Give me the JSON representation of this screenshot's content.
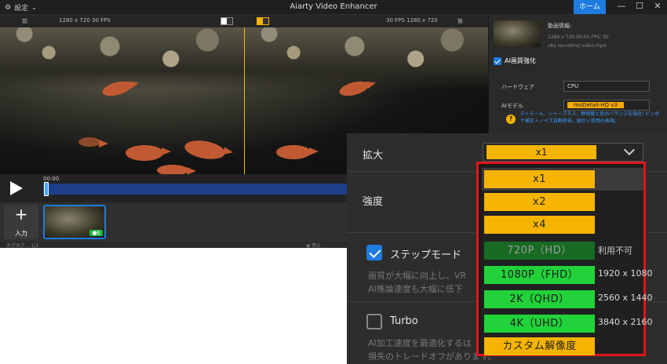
{
  "titlebar": {
    "settings_label": "設定",
    "app_title": "Aiarty Video Enhancer",
    "home_button": "ホーム",
    "minimize": "—",
    "maximize": "☐",
    "close": "✕"
  },
  "compare": {
    "before_label": "前",
    "left_info": "1280 x 720  30 FPS",
    "right_info": "30 FPS  1280 x 720",
    "after_label": "後"
  },
  "timeline": {
    "time": "00:00",
    "progress": 0.0
  },
  "strip": {
    "add_label": "入力",
    "clip_badge": "●E",
    "status_left": "カクカク... 1/1",
    "status_right": "◉ 停止"
  },
  "right_panel": {
    "info_title": "動画情報:",
    "info_meta": "1280 x 720   00:05   FPS: 30",
    "info_file": "obs recording video.mp4",
    "ai_section": "AI画質強化",
    "hardware_label": "ハードウェア",
    "hardware_value": "CPU",
    "model_label": "AIモデル",
    "model_value": "moDetail-HQ v3",
    "description": "ディテール、シャープネス、鮮明度と色のバランスを強化! ビンボケ補正＋ノイズ自動除去。細かい質感の表現。"
  },
  "popup": {
    "scale_label": "拡大",
    "scale_value": "x1",
    "strength_label": "強度",
    "step_mode_label": "ステップモード",
    "step_mode_note1": "画質が大幅に向上し、VR",
    "step_mode_note2": "AI推論速度も大幅に低下",
    "turbo_label": "Turbo",
    "turbo_note1": "AI加工速度を最適化するは",
    "turbo_note2": "損失のトレードオフがあります。"
  },
  "dropdown": {
    "options": [
      {
        "label": "x1",
        "style": "gold",
        "side": ""
      },
      {
        "label": "x2",
        "style": "gold",
        "side": ""
      },
      {
        "label": "x4",
        "style": "gold",
        "side": ""
      },
      {
        "label": "720P（HD）",
        "style": "dark",
        "side": "利用不可"
      },
      {
        "label": "1080P（FHD）",
        "style": "green",
        "side": "1920 x 1080"
      },
      {
        "label": "2K（QHD）",
        "style": "green",
        "side": "2560 x 1440"
      },
      {
        "label": "4K（UHD）",
        "style": "green",
        "side": "3840 x 2160"
      },
      {
        "label": "カスタム解像度",
        "style": "gold",
        "side": ""
      }
    ]
  },
  "colors": {
    "accent_blue": "#1e7be0",
    "gold": "#f5b400",
    "green": "#22d23a",
    "highlight_red": "#e0151b"
  }
}
